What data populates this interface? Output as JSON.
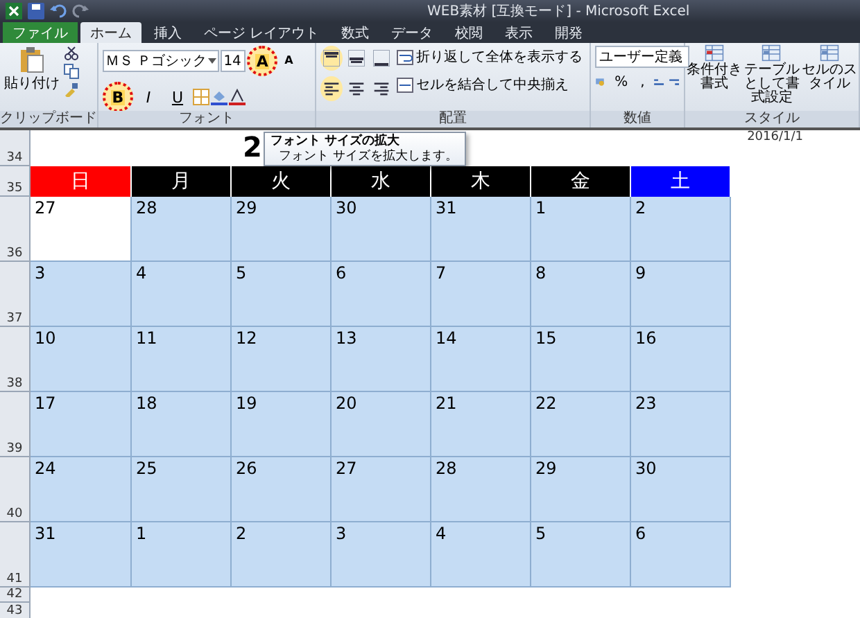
{
  "window": {
    "title": "WEB素材 [互換モード] - Microsoft Excel"
  },
  "tabs": [
    {
      "label": "ファイル",
      "kind": "file",
      "selected": false
    },
    {
      "label": "ホーム",
      "kind": "tab",
      "selected": true
    },
    {
      "label": "挿入",
      "kind": "tab",
      "selected": false
    },
    {
      "label": "ページ レイアウト",
      "kind": "tab",
      "selected": false
    },
    {
      "label": "数式",
      "kind": "tab",
      "selected": false
    },
    {
      "label": "データ",
      "kind": "tab",
      "selected": false
    },
    {
      "label": "校閲",
      "kind": "tab",
      "selected": false
    },
    {
      "label": "表示",
      "kind": "tab",
      "selected": false
    },
    {
      "label": "開発",
      "kind": "tab",
      "selected": false
    }
  ],
  "clipboard": {
    "paste_label": "貼り付け",
    "group_label": "クリップボード"
  },
  "font": {
    "font_name": "ＭＳ Ｐゴシック",
    "font_size": "14",
    "group_label": "フォント",
    "top_buttons": [
      {
        "label": "A",
        "kind": "grow",
        "highlighted": true
      },
      {
        "label": "A",
        "kind": "shrink",
        "highlighted": false
      }
    ],
    "bottom_buttons": [
      {
        "label": "B",
        "kind": "bold",
        "highlighted": true
      },
      {
        "label": "I",
        "kind": "italic",
        "highlighted": false
      },
      {
        "label": "U",
        "kind": "underline",
        "highlighted": false
      }
    ]
  },
  "alignment": {
    "group_label": "配置",
    "wrap_label": "折り返して全体を表示する",
    "merge_label": "セルを結合して中央揃え",
    "top_buttons": [
      {
        "kind": "top",
        "highlighted": true
      },
      {
        "kind": "middle",
        "highlighted": false
      },
      {
        "kind": "bottom",
        "highlighted": false
      }
    ],
    "bottom_buttons": [
      {
        "kind": "left",
        "highlighted": true
      },
      {
        "kind": "center",
        "highlighted": false
      },
      {
        "kind": "right",
        "highlighted": false
      }
    ]
  },
  "number": {
    "group_label": "数値",
    "format": "ユーザー定義",
    "percent": "%",
    "comma": ","
  },
  "styles": {
    "group_label": "スタイル",
    "buttons": [
      "条件付き書式",
      "テーブルとして書式設定",
      "セルのスタイル"
    ]
  },
  "sheet": {
    "row_headers": [
      "34",
      "35",
      "36",
      "37",
      "38",
      "39",
      "40",
      "41",
      "42",
      "43"
    ],
    "title": "2",
    "date": "2016/1/1",
    "weekdays": [
      {
        "label": "日",
        "color": "#ff0000"
      },
      {
        "label": "月",
        "color": "#000000"
      },
      {
        "label": "火",
        "color": "#000000"
      },
      {
        "label": "水",
        "color": "#000000"
      },
      {
        "label": "木",
        "color": "#000000"
      },
      {
        "label": "金",
        "color": "#000000"
      },
      {
        "label": "土",
        "color": "#0000ff"
      }
    ],
    "weeks": [
      [
        {
          "day": "27",
          "active": true
        },
        {
          "day": "28",
          "active": false
        },
        {
          "day": "29",
          "active": false
        },
        {
          "day": "30",
          "active": false
        },
        {
          "day": "31",
          "active": false
        },
        {
          "day": "1",
          "active": false
        },
        {
          "day": "2",
          "active": false
        }
      ],
      [
        {
          "day": "3",
          "active": false
        },
        {
          "day": "4",
          "active": false
        },
        {
          "day": "5",
          "active": false
        },
        {
          "day": "6",
          "active": false
        },
        {
          "day": "7",
          "active": false
        },
        {
          "day": "8",
          "active": false
        },
        {
          "day": "9",
          "active": false
        }
      ],
      [
        {
          "day": "10",
          "active": false
        },
        {
          "day": "11",
          "active": false
        },
        {
          "day": "12",
          "active": false
        },
        {
          "day": "13",
          "active": false
        },
        {
          "day": "14",
          "active": false
        },
        {
          "day": "15",
          "active": false
        },
        {
          "day": "16",
          "active": false
        }
      ],
      [
        {
          "day": "17",
          "active": false
        },
        {
          "day": "18",
          "active": false
        },
        {
          "day": "19",
          "active": false
        },
        {
          "day": "20",
          "active": false
        },
        {
          "day": "21",
          "active": false
        },
        {
          "day": "22",
          "active": false
        },
        {
          "day": "23",
          "active": false
        }
      ],
      [
        {
          "day": "24",
          "active": false
        },
        {
          "day": "25",
          "active": false
        },
        {
          "day": "26",
          "active": false
        },
        {
          "day": "27",
          "active": false
        },
        {
          "day": "28",
          "active": false
        },
        {
          "day": "29",
          "active": false
        },
        {
          "day": "30",
          "active": false
        }
      ],
      [
        {
          "day": "31",
          "active": false
        },
        {
          "day": "1",
          "active": false
        },
        {
          "day": "2",
          "active": false
        },
        {
          "day": "3",
          "active": false
        },
        {
          "day": "4",
          "active": false
        },
        {
          "day": "5",
          "active": false
        },
        {
          "day": "6",
          "active": false
        }
      ]
    ]
  },
  "tooltip": {
    "title": "フォント サイズの拡大",
    "body": "フォント サイズを拡大します。"
  }
}
